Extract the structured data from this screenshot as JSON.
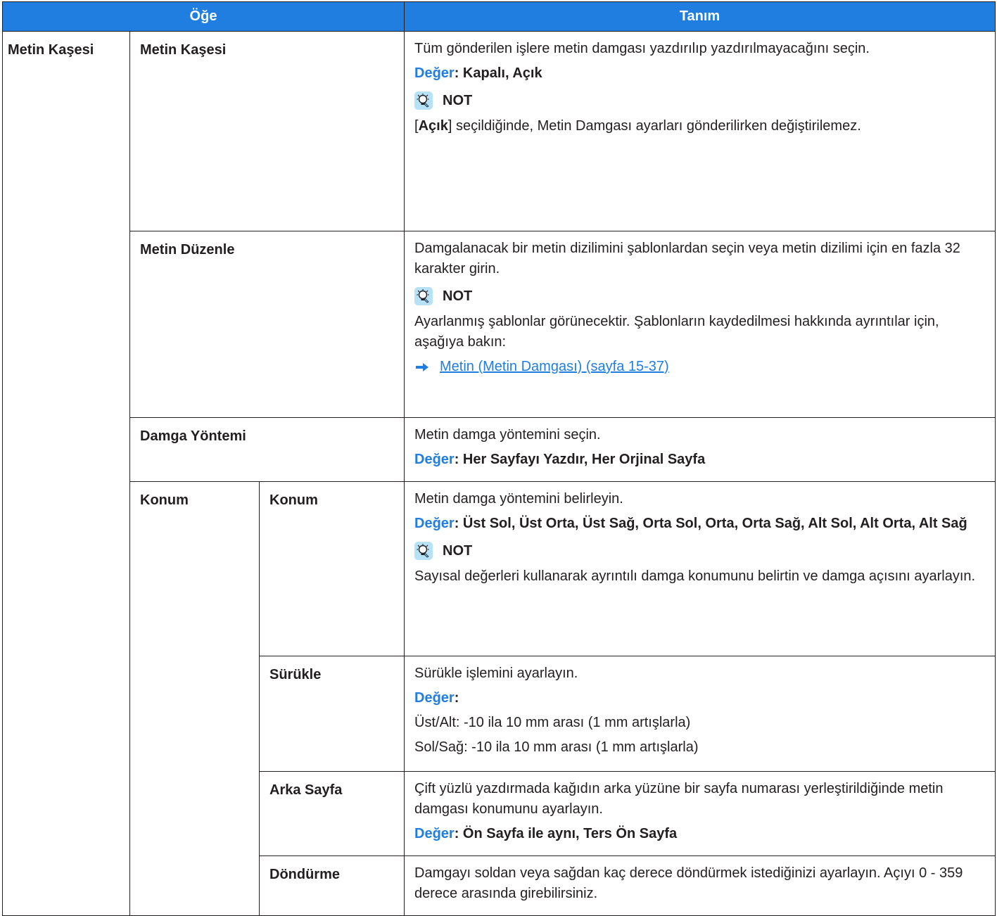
{
  "header": {
    "item": "Öğe",
    "desc": "Tanım"
  },
  "note_label": "NOT",
  "value_label": "Değer",
  "group": "Metin Kaşesi",
  "rows": [
    {
      "item": "Metin Kaşesi",
      "desc": "Tüm gönderilen işlere metin damgası yazdırılıp yazdırılmayacağını seçin.",
      "value": ": Kapalı, Açık",
      "note_pre": "[",
      "note_bold": "Açık",
      "note_post": "] seçildiğinde, Metin Damgası ayarları gönderilirken değiştirilemez."
    },
    {
      "item": "Metin Düzenle",
      "desc": "Damgalanacak bir metin dizilimini şablonlardan seçin veya metin dizilimi için en fazla 32 karakter girin.",
      "note": "Ayarlanmış şablonlar görünecektir. Şablonların kaydedilmesi hakkında ayrıntılar için, aşağıya bakın:",
      "link": "Metin (Metin Damgası) (sayfa 15-37)"
    },
    {
      "item": "Damga Yöntemi",
      "desc": "Metin damga yöntemini seçin.",
      "value": ": Her Sayfayı Yazdır, Her Orjinal Sayfa"
    }
  ],
  "konum": {
    "label": "Konum",
    "rows": [
      {
        "item": "Konum",
        "desc": "Metin damga yöntemini belirleyin.",
        "value": ": Üst Sol, Üst Orta, Üst Sağ, Orta Sol, Orta, Orta Sağ, Alt Sol, Alt Orta, Alt Sağ",
        "note": "Sayısal değerleri kullanarak ayrıntılı damga konumunu belirtin ve damga açısını ayarlayın."
      },
      {
        "item": "Sürükle",
        "desc": "Sürükle işlemini ayarlayın.",
        "value": ":",
        "line1": "Üst/Alt: -10 ila 10 mm arası (1 mm artışlarla)",
        "line2": "Sol/Sağ: -10 ila 10 mm arası (1 mm artışlarla)"
      },
      {
        "item": "Arka Sayfa",
        "desc": "Çift yüzlü yazdırmada kağıdın arka yüzüne bir sayfa numarası yerleştirildiğinde metin damgası konumunu ayarlayın.",
        "value": ": Ön Sayfa ile aynı, Ters Ön Sayfa"
      },
      {
        "item": "Döndürme",
        "desc": "Damgayı soldan veya sağdan kaç derece döndürmek istediğinizi ayarlayın. Açıyı 0 - 359 derece arasında girebilirsiniz."
      }
    ]
  }
}
